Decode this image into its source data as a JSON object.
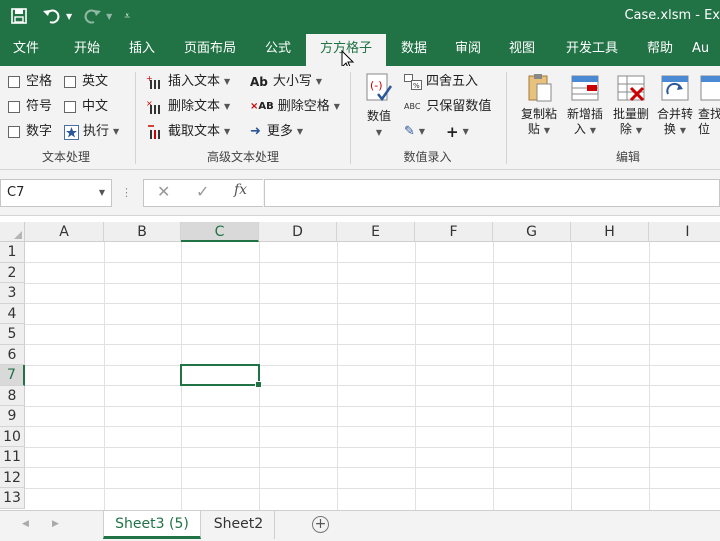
{
  "titlebar": {
    "title": "Case.xlsm - Ex",
    "qat_icons": [
      "save-icon",
      "undo-icon",
      "redo-icon",
      "customize-qat-icon"
    ]
  },
  "tabs": [
    {
      "label": "文件"
    },
    {
      "label": "开始"
    },
    {
      "label": "插入"
    },
    {
      "label": "页面布局"
    },
    {
      "label": "公式"
    },
    {
      "label": "方方格子"
    },
    {
      "label": "数据"
    },
    {
      "label": "审阅"
    },
    {
      "label": "视图"
    },
    {
      "label": "开发工具"
    },
    {
      "label": "帮助"
    },
    {
      "label": "Au"
    }
  ],
  "ribbon": {
    "text_group": {
      "label": "文本处理",
      "items": [
        "空格",
        "英文",
        "符号",
        "中文",
        "数字",
        "执行"
      ]
    },
    "adv_group": {
      "label": "高级文本处理",
      "items": [
        "插入文本",
        "大小写",
        "删除文本",
        "删除空格",
        "截取文本",
        "更多"
      ]
    },
    "num_group": {
      "label": "数值录入",
      "value_btn": "数值",
      "round": "四舍五入",
      "keep_values": "只保留数值"
    },
    "edit_group": {
      "label": "编辑",
      "buttons": [
        {
          "line1": "复制粘",
          "line2": "贴"
        },
        {
          "line1": "新增插",
          "line2": "入"
        },
        {
          "line1": "批量删",
          "line2": "除"
        },
        {
          "line1": "合并转",
          "line2": "换"
        },
        {
          "line1": "查找",
          "line2": "位"
        }
      ]
    }
  },
  "formula_bar": {
    "name_box": "C7",
    "fx": "fx",
    "formula": ""
  },
  "grid": {
    "columns": [
      "A",
      "B",
      "C",
      "D",
      "E",
      "F",
      "G",
      "H",
      "I"
    ],
    "rows": [
      "1",
      "2",
      "3",
      "4",
      "5",
      "6",
      "7",
      "8",
      "9",
      "10",
      "11",
      "12",
      "13"
    ],
    "selected_cell": "C7"
  },
  "sheets": [
    {
      "name": "Sheet3 (5)",
      "active": true
    },
    {
      "name": "Sheet2",
      "active": false
    }
  ],
  "colors": {
    "accent": "#217346",
    "ribbon_bg": "#f3f3f3"
  }
}
